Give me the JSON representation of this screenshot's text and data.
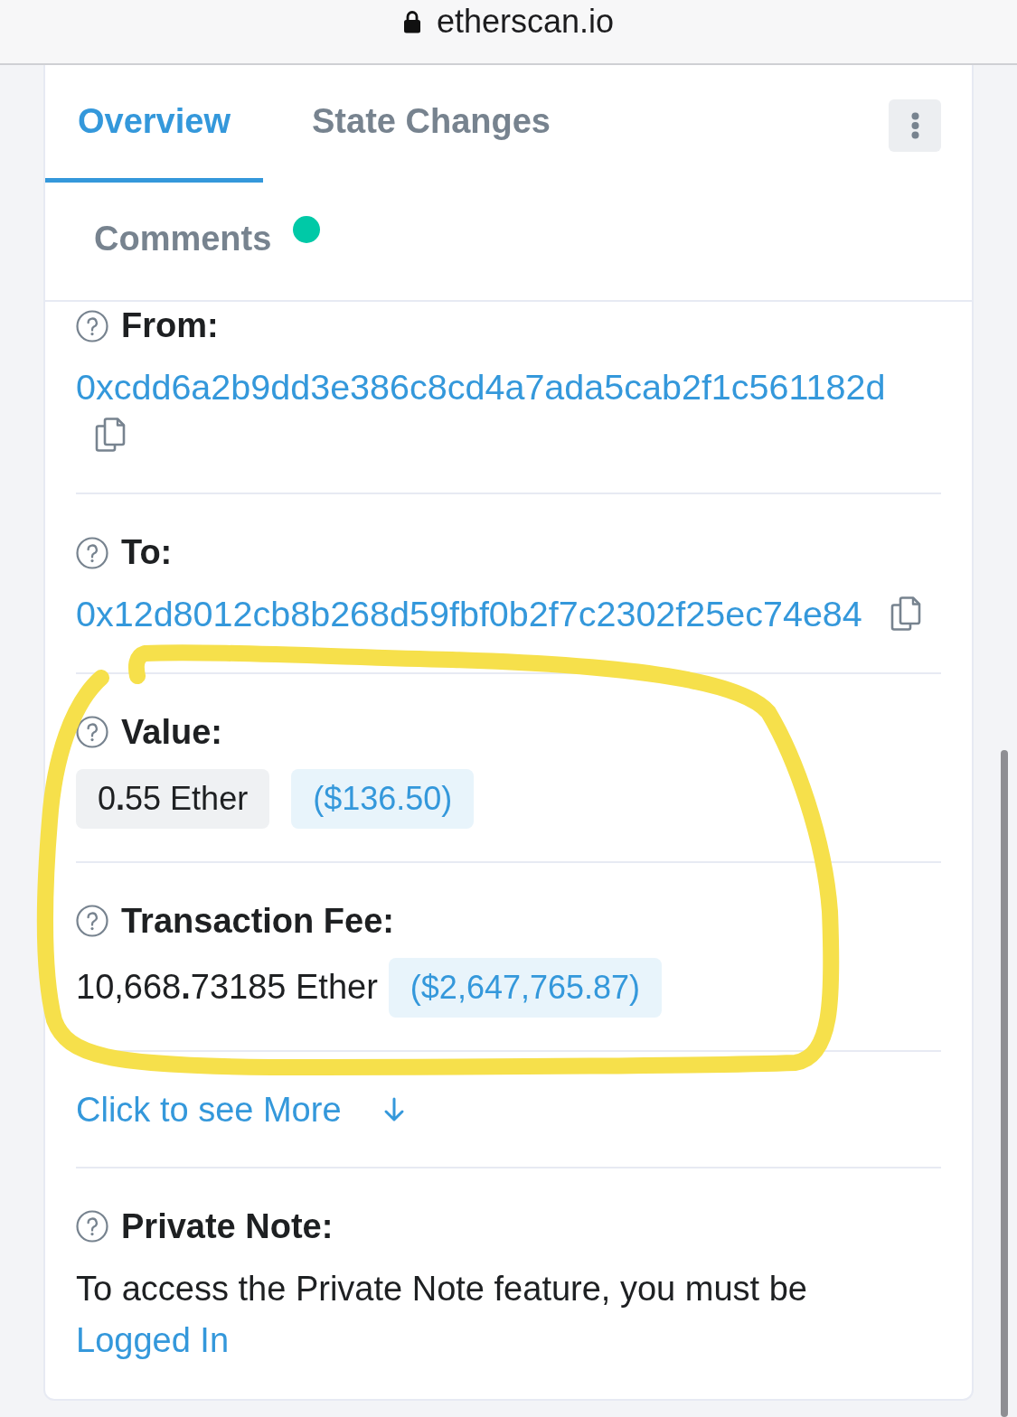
{
  "browser": {
    "url": "etherscan.io",
    "secure": true
  },
  "tabs": [
    {
      "label": "Overview",
      "selected": true,
      "unread": false
    },
    {
      "label": "State Changes",
      "selected": false,
      "unread": false
    },
    {
      "label": "Comments",
      "selected": false,
      "unread": true
    }
  ],
  "fields": [
    {
      "kind": "address",
      "label": "From:",
      "value": "0xcdd6a2b9dd3e386c8cd4a7ada5cab2f1c561182d",
      "copyable": true,
      "highlighted": false
    },
    {
      "kind": "address",
      "label": "To:",
      "value": "0x12d8012cb8b268d59fbf0b2f7c2302f25ec74e84",
      "copyable": true,
      "highlighted": false
    },
    {
      "kind": "amount",
      "label": "Value:",
      "amount": "0**.**55 Ether",
      "boxed": true,
      "usd": "($136.50)",
      "highlighted": true
    },
    {
      "kind": "amount",
      "label": "Transaction Fee:",
      "amount": "10,668**.**73185 Ether",
      "boxed": false,
      "usd": "($2,647,765.87)",
      "highlighted": true
    },
    {
      "kind": "toggle",
      "label": "Click to see More",
      "expanded": false,
      "highlighted": false
    },
    {
      "kind": "note",
      "label": "Private Note:",
      "text": "To access the Private Note feature, you must be",
      "link": "Logged In",
      "highlighted": false
    }
  ]
}
